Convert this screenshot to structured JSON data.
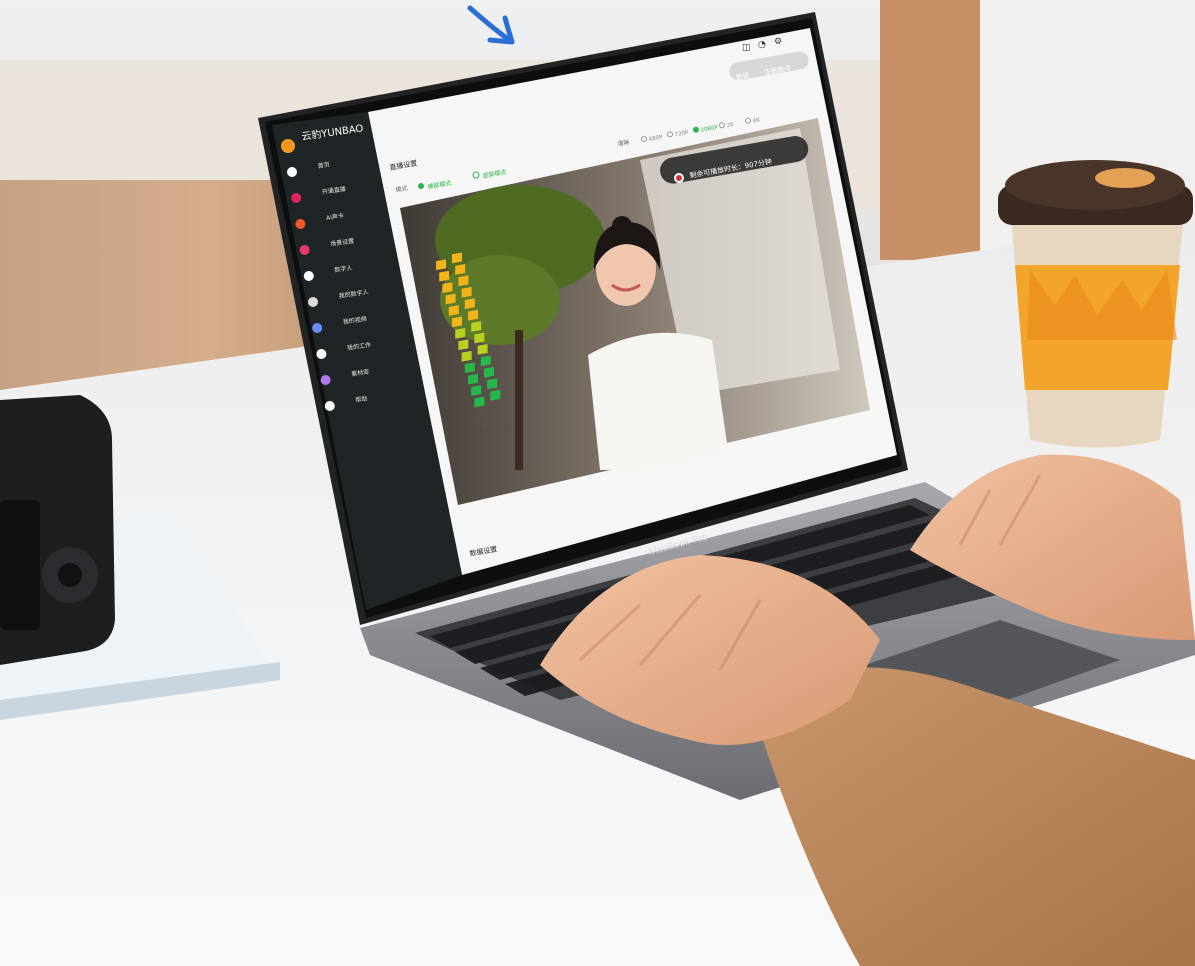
{
  "scene": {
    "description_free": true,
    "colors": {
      "wall": "#e9e6e3",
      "desk": "#f3f3f3",
      "wood": "#c79b73",
      "laptop_body": "#8d8e92",
      "screen_bezel": "#141516",
      "sidebar": "#1f2527",
      "accent_green": "#2fb44a",
      "skin": "#e9b28f",
      "sleeve": "#b98458",
      "cup_orange": "#f3a42a"
    }
  },
  "laptop": {
    "brand_label": "MacBook Pro"
  },
  "app": {
    "logo_text": "云豹YUNBAO",
    "sidebar": {
      "items": [
        {
          "label": "首页",
          "icon": "home-icon"
        },
        {
          "label": "开通直播",
          "icon": "broadcast-icon"
        },
        {
          "label": "AI声卡",
          "icon": "soundcard-icon"
        },
        {
          "label": "场景设置",
          "icon": "scene-icon"
        },
        {
          "label": "数字人",
          "icon": "avatar-icon"
        },
        {
          "label": "我的数字人",
          "icon": "user-icon"
        },
        {
          "label": "我的视频",
          "icon": "video-icon"
        },
        {
          "label": "我的工作",
          "icon": "work-icon"
        },
        {
          "label": "素材库",
          "icon": "library-icon"
        },
        {
          "label": "帮助",
          "icon": "help-icon"
        }
      ]
    },
    "top_buttons": [
      "登录",
      "注册账号"
    ],
    "section_title": "直播设置",
    "resolution_label": "清晰",
    "resolution_options": [
      "480P",
      "720P",
      "1080P",
      "2K",
      "4K"
    ],
    "resolution_selected": "1080P",
    "mode_label": "模式",
    "mode_options": [
      "横屏模式",
      "竖屏模式"
    ],
    "status_toast": "剩余可播放时长：907分钟",
    "bottom_label": "数据设置",
    "audio_level": 0.82
  }
}
